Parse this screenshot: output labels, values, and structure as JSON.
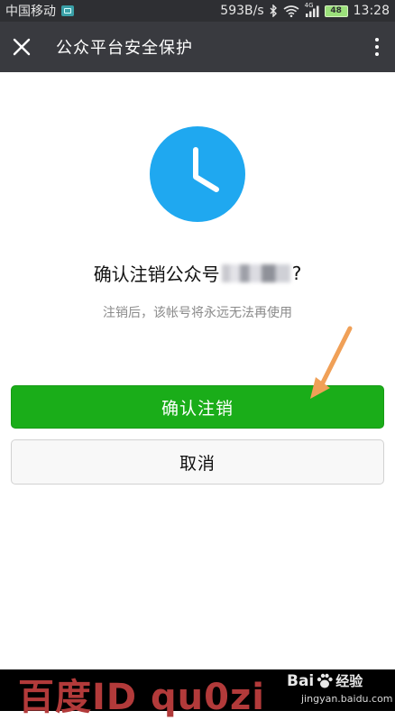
{
  "status_bar": {
    "carrier": "中国移动",
    "network_speed": "593B/s",
    "battery_level": "48",
    "time": "13:28",
    "network_type": "4G"
  },
  "title_bar": {
    "title": "公众平台安全保护",
    "close_icon": "close-icon",
    "more_icon": "more-vertical-icon"
  },
  "dialog": {
    "icon": "clock-icon",
    "headline_prefix": "确认注销公众号",
    "headline_suffix": "?",
    "subtext": "注销后，该帐号将永远无法再使用",
    "confirm_label": "确认注销",
    "cancel_label": "取消"
  },
  "colors": {
    "status_bar_bg": "#2e2f33",
    "title_bar_bg": "#393a3f",
    "clock_blue": "#1fa8f0",
    "confirm_green": "#1aad19",
    "arrow_orange": "#f0a057"
  },
  "overlay": {
    "watermark": "百度ID qu0zi",
    "logo_text": "Bai",
    "logo_text_2": "经验",
    "logo_url": "jingyan.baidu.com"
  }
}
